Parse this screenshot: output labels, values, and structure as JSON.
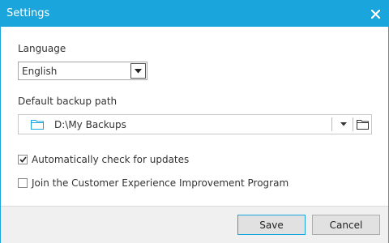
{
  "window": {
    "title": "Settings"
  },
  "language": {
    "label": "Language",
    "value": "English"
  },
  "backup": {
    "label": "Default backup path",
    "value": "D:\\My Backups"
  },
  "options": [
    {
      "label": "Automatically check for updates",
      "checked": true
    },
    {
      "label": "Join the Customer Experience Improvement Program",
      "checked": false
    }
  ],
  "footer": {
    "save_label": "Save",
    "cancel_label": "Cancel"
  },
  "colors": {
    "accent": "#1aa6dc",
    "footer_bg": "#f0f0f0"
  },
  "icons": [
    "close-icon",
    "chevron-down-icon",
    "folder-icon",
    "browse-folder-icon",
    "checkmark-icon"
  ]
}
